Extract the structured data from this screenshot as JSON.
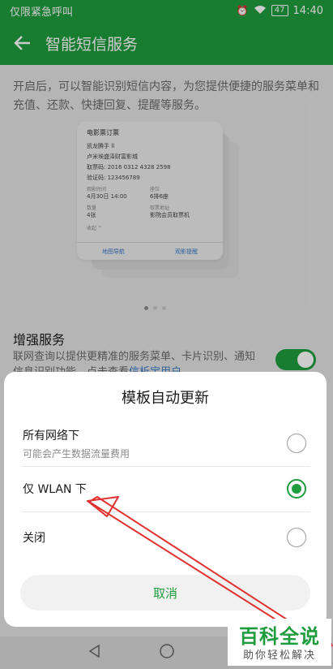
{
  "status_bar": {
    "carrier": "仅限紧急呼叫",
    "battery": "47",
    "time": "14:40"
  },
  "app_bar": {
    "title": "智能短信服务"
  },
  "page": {
    "description": "开启后，可以智能识别短信内容，为您提供便捷的服务菜单和充值、还款、快捷回复、提醒等服务。",
    "ticket": {
      "title": "电影票订票",
      "greeting": "凯龙腾手 ll",
      "cinema": "卢米埃盛泽财富影城",
      "code_line": "取票码: 2016 0312 4328 2598",
      "verify_line": "验证码: 123456789",
      "time_label": "观影时间",
      "time_value": "4月30日 14:00",
      "seat_label": "座位",
      "seat_value": "6排6座",
      "count_label": "数量",
      "count_value": "4张",
      "addr_label": "取票地址",
      "addr_value": "影院会员取票机",
      "collapse": "收起",
      "action_map": "地图导航",
      "action_remind": "观影提醒"
    },
    "enhanced": {
      "title": "增强服务",
      "description_line1": "联网查询以提供更精准的服务菜单、卡片识",
      "description_line2": "别、通知信息识别功能。点击查看",
      "link": "信析宝用户"
    }
  },
  "dialog": {
    "title": "模板自动更新",
    "options": [
      {
        "label": "所有网络下",
        "sublabel": "可能会产生数据流量费用",
        "selected": false
      },
      {
        "label": "仅 WLAN 下",
        "sublabel": "",
        "selected": true
      },
      {
        "label": "关闭",
        "sublabel": "",
        "selected": false
      }
    ],
    "cancel": "取消"
  },
  "watermark": {
    "brand": "百科全说",
    "slogan": "助你轻松解决"
  },
  "colors": {
    "accent": "#1f9c3e",
    "annotation_arrow": "#e03030"
  },
  "icons": {
    "back": "back-arrow-icon",
    "wifi": "wifi-icon",
    "nav_back": "nav-back-icon",
    "nav_home": "nav-home-icon",
    "nav_recents": "nav-recents-icon"
  }
}
